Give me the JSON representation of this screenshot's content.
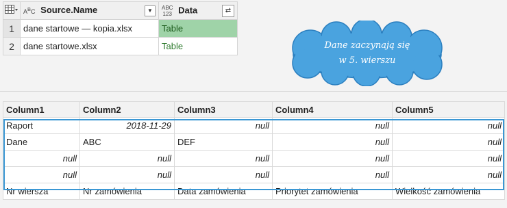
{
  "source_table": {
    "headers": {
      "name": "Source.Name",
      "name_type": "A B C",
      "data": "Data",
      "data_type": "ABC 123"
    },
    "rows": [
      {
        "num": "1",
        "name": "dane startowe — kopia.xlsx",
        "data": "Table"
      },
      {
        "num": "2",
        "name": "dane startowe.xlsx",
        "data": "Table"
      }
    ]
  },
  "callout": {
    "line1": "Dane zaczynają się",
    "line2": "w 5. wierszu",
    "color": "#3a97d4"
  },
  "preview_table": {
    "columns": [
      "Column1",
      "Column2",
      "Column3",
      "Column4",
      "Column5"
    ],
    "rows": [
      [
        "Raport",
        "2018-11-29",
        "null",
        "null",
        "null"
      ],
      [
        "Dane",
        "ABC",
        "DEF",
        "null",
        "null"
      ],
      [
        "null",
        "null",
        "null",
        "null",
        "null"
      ],
      [
        "null",
        "null",
        "null",
        "null",
        "null"
      ],
      [
        "Nr wiersza",
        "Nr zamówienia",
        "Data zamówienia",
        "Priorytet zamówienia",
        "Wielkość zamówienia"
      ]
    ]
  },
  "colors": {
    "selected_cell": "#9fd3a8",
    "highlight_border": "#3a97d4"
  }
}
